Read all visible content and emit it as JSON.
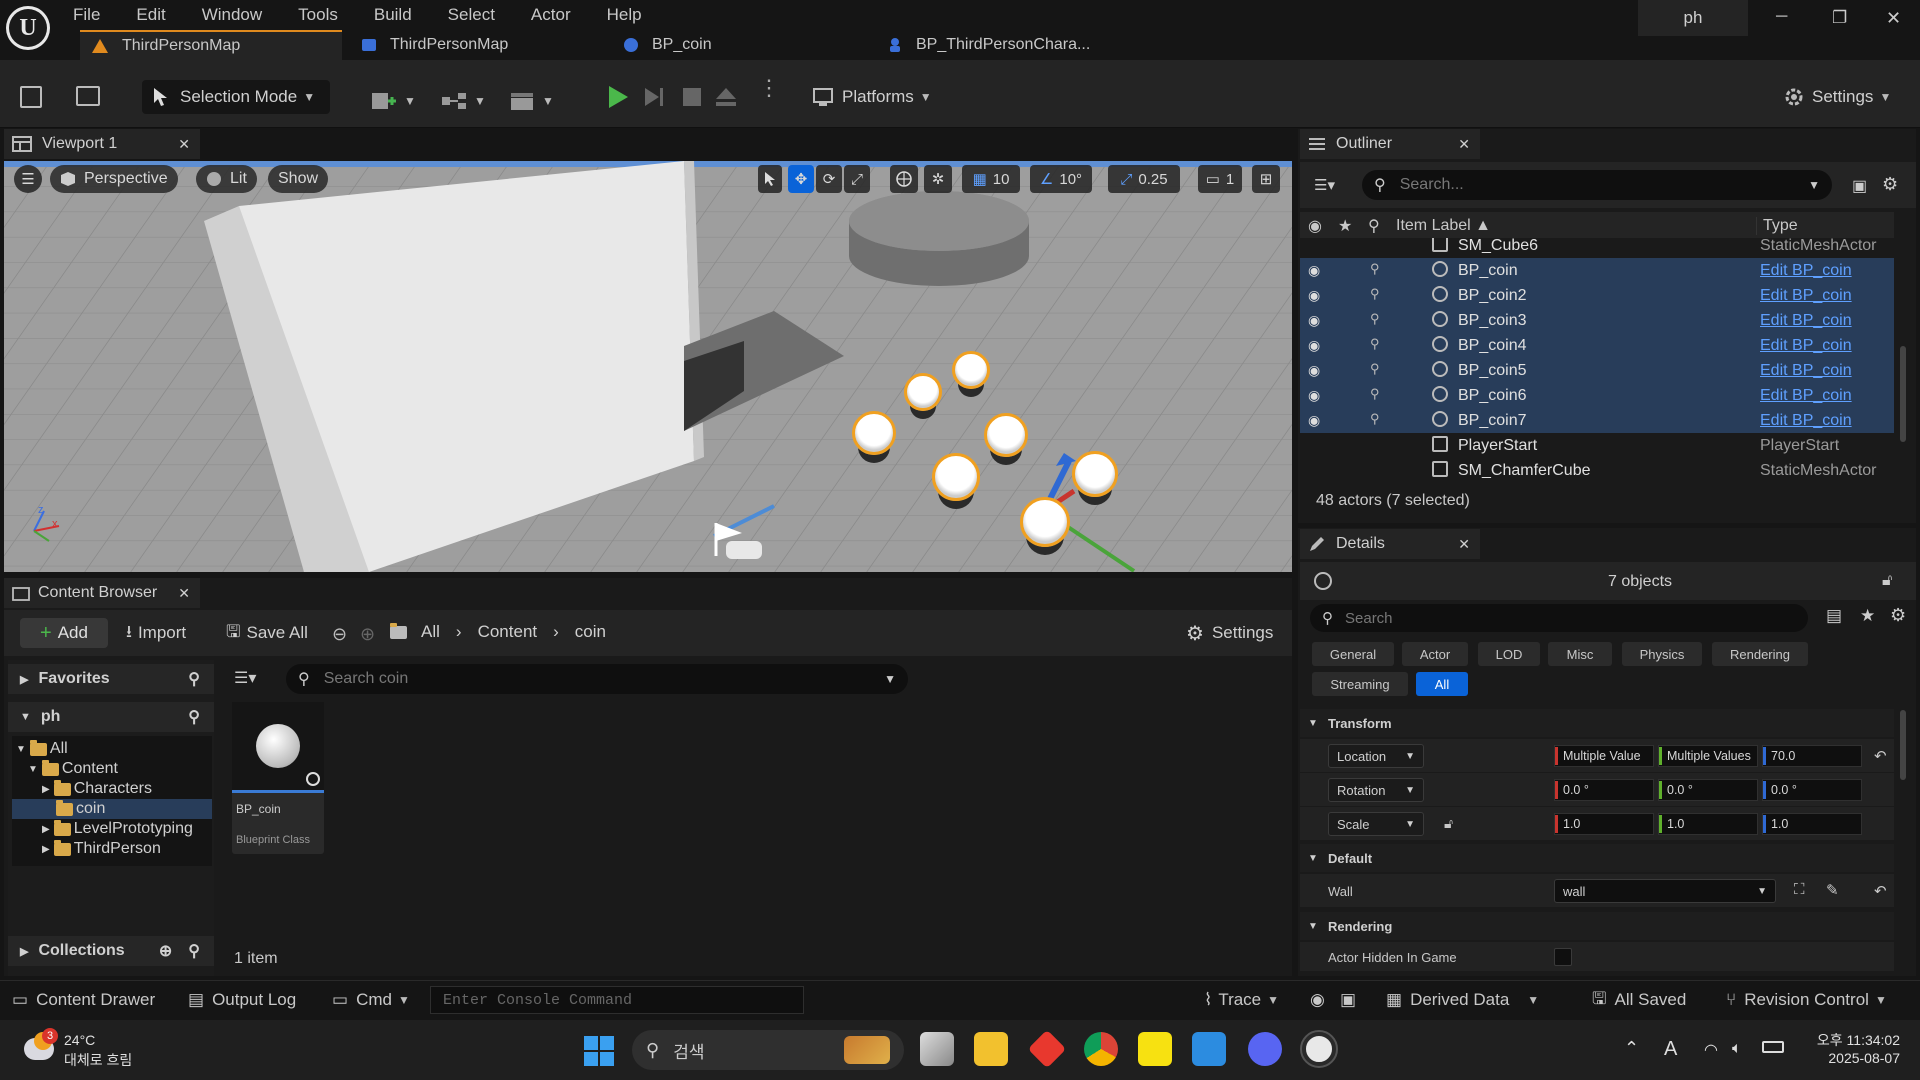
{
  "menu": [
    "File",
    "Edit",
    "Window",
    "Tools",
    "Build",
    "Select",
    "Actor",
    "Help"
  ],
  "window": {
    "project": "ph",
    "minimize": "─",
    "restore": "❐",
    "close": "✕"
  },
  "tabs": [
    {
      "label": "ThirdPersonMap",
      "active": true
    },
    {
      "label": "ThirdPersonMap",
      "active": false
    },
    {
      "label": "BP_coin",
      "active": false
    },
    {
      "label": "BP_ThirdPersonChara...",
      "active": false
    }
  ],
  "toolbar": {
    "selection_mode": "Selection Mode",
    "platforms": "Platforms",
    "settings": "Settings"
  },
  "viewport": {
    "tab_label": "Viewport 1",
    "perspective": "Perspective",
    "lit": "Lit",
    "show": "Show",
    "grid_snap": "10",
    "rot_snap": "10°",
    "scale_snap": "0.25",
    "camera_speed": "1"
  },
  "content_browser": {
    "tab_label": "Content Browser",
    "add": "Add",
    "import": "Import",
    "save_all": "Save All",
    "path": [
      "All",
      "Content",
      "coin"
    ],
    "settings": "Settings",
    "favorites": "Favorites",
    "project": "ph",
    "tree": [
      {
        "label": "All",
        "level": 0
      },
      {
        "label": "Content",
        "level": 1
      },
      {
        "label": "Characters",
        "level": 2
      },
      {
        "label": "coin",
        "level": 2,
        "selected": true
      },
      {
        "label": "LevelPrototyping",
        "level": 2
      },
      {
        "label": "ThirdPerson",
        "level": 2
      }
    ],
    "collections": "Collections",
    "search_placeholder": "Search coin",
    "asset": {
      "name": "BP_coin",
      "type": "Blueprint Class"
    },
    "count": "1 item"
  },
  "outliner": {
    "tab_label": "Outliner",
    "search_placeholder": "Search...",
    "col_label": "Item Label ▲",
    "col_type": "Type",
    "rows": [
      {
        "label": "SM_Cube6",
        "type": "StaticMeshActor",
        "selected": false,
        "link": false
      },
      {
        "label": "BP_coin",
        "type": "Edit BP_coin",
        "selected": true,
        "link": true
      },
      {
        "label": "BP_coin2",
        "type": "Edit BP_coin",
        "selected": true,
        "link": true
      },
      {
        "label": "BP_coin3",
        "type": "Edit BP_coin",
        "selected": true,
        "link": true
      },
      {
        "label": "BP_coin4",
        "type": "Edit BP_coin",
        "selected": true,
        "link": true
      },
      {
        "label": "BP_coin5",
        "type": "Edit BP_coin",
        "selected": true,
        "link": true
      },
      {
        "label": "BP_coin6",
        "type": "Edit BP_coin",
        "selected": true,
        "link": true
      },
      {
        "label": "BP_coin7",
        "type": "Edit BP_coin",
        "selected": true,
        "link": true
      },
      {
        "label": "PlayerStart",
        "type": "PlayerStart",
        "selected": false,
        "link": false
      },
      {
        "label": "SM_ChamferCube",
        "type": "StaticMeshActor",
        "selected": false,
        "link": false
      }
    ],
    "status": "48 actors (7 selected)"
  },
  "details": {
    "tab_label": "Details",
    "objects": "7 objects",
    "search_placeholder": "Search",
    "filters": [
      "General",
      "Actor",
      "LOD",
      "Misc",
      "Physics",
      "Rendering",
      "Streaming",
      "All"
    ],
    "transform_label": "Transform",
    "location_label": "Location",
    "location": [
      "Multiple Value",
      "Multiple Values",
      "70.0"
    ],
    "rotation_label": "Rotation",
    "rotation": [
      "0.0 °",
      "0.0 °",
      "0.0 °"
    ],
    "scale_label": "Scale",
    "scale": [
      "1.0",
      "1.0",
      "1.0"
    ],
    "default_label": "Default",
    "wall_label": "Wall",
    "wall_value": "wall",
    "rendering_label": "Rendering",
    "hidden_label": "Actor Hidden In Game"
  },
  "statusbar": {
    "content_drawer": "Content Drawer",
    "output_log": "Output Log",
    "cmd": "Cmd",
    "console_placeholder": "Enter Console Command",
    "trace": "Trace",
    "derived_data": "Derived Data",
    "all_saved": "All Saved",
    "revision_control": "Revision Control"
  },
  "taskbar": {
    "weather_temp": "24°C",
    "weather_desc": "대체로 흐림",
    "weather_badge": "3",
    "search": "검색",
    "time": "오후 11:34:02",
    "date": "2025-08-07",
    "ime": "A"
  },
  "colors": {
    "accent": "#0a63d8",
    "selection": "#283d5a",
    "tab_accent": "#e08a1e",
    "link": "#5fa0ff"
  }
}
